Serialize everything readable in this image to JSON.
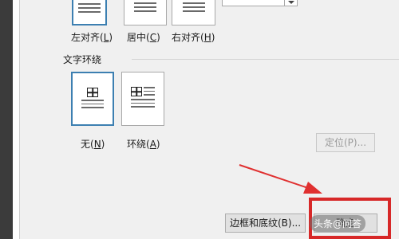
{
  "alignment": {
    "options": [
      {
        "label": "左对齐(",
        "key": "L",
        "suffix": ")"
      },
      {
        "label": "居中(",
        "key": "C",
        "suffix": ")"
      },
      {
        "label": "右对齐(",
        "key": "H",
        "suffix": ")"
      }
    ],
    "dropdown_value": "▼"
  },
  "wrap": {
    "section_title": "文字环绕",
    "options": [
      {
        "label": "无(",
        "key": "N",
        "suffix": ")"
      },
      {
        "label": "环绕(",
        "key": "A",
        "suffix": ")"
      }
    ]
  },
  "buttons": {
    "position": "定位(P)...",
    "borders": "边框和底纹(B)...",
    "ok": "确定"
  },
  "watermark": "头条@问答",
  "colors": {
    "selected_border": "#3c7fb1",
    "highlight": "#d72828",
    "arrow": "#e03030"
  }
}
